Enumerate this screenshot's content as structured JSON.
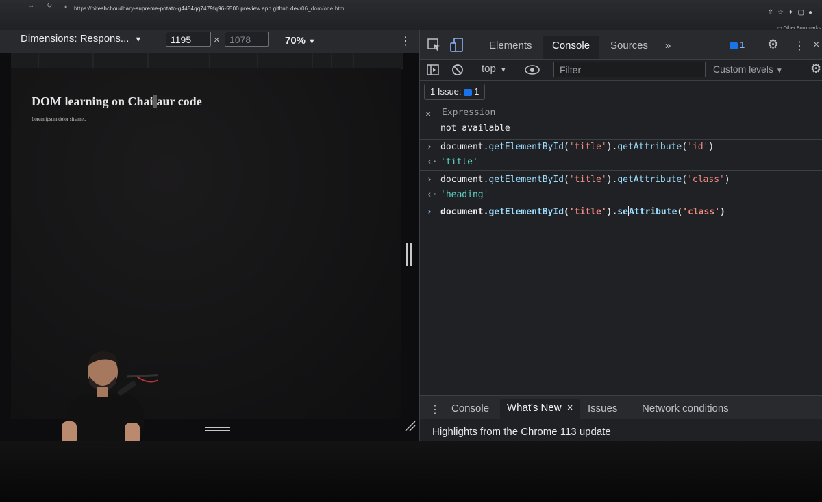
{
  "browser": {
    "url_prefix": "https://",
    "url_host": "hiteshchoudhary-supreme-potato-g4454qq7479fq96-5500.preview.app.github.dev",
    "url_path": "/06_dom/one.html",
    "bookmarks_label": "Other Bookmarks"
  },
  "device_toolbar": {
    "dimensions_label": "Dimensions: Respons...",
    "width_value": "1195",
    "height_value": "1078",
    "zoom_label": "70%"
  },
  "page": {
    "heading_before_cursor": "DOM learning on Chai",
    "heading_after_cursor": "aur code",
    "paragraph": "Lorem ipsum dolor sit amet."
  },
  "devtools": {
    "tabs": [
      "Elements",
      "Console",
      "Sources"
    ],
    "active_tab": "Console",
    "more_tabs": "»",
    "issue_count": "1",
    "console_toolbar": {
      "context": "top",
      "filter_placeholder": "Filter",
      "levels": "Custom levels"
    },
    "issues_label": "1 Issue:",
    "issues_count": "1",
    "live_expression": {
      "label": "Expression",
      "value": "not available"
    },
    "entries": [
      {
        "obj": "document",
        "dot1": ".",
        "m1": "getElementById",
        "p1": "(",
        "a1": "'title'",
        "p2": ")",
        "dot2": ".",
        "m2": "getAttribute",
        "p3": "(",
        "a2": "'id'",
        "p4": ")",
        "result": "'title'"
      },
      {
        "obj": "document",
        "dot1": ".",
        "m1": "getElementById",
        "p1": "(",
        "a1": "'title'",
        "p2": ")",
        "dot2": ".",
        "m2": "getAttribute",
        "p3": "(",
        "a2": "'class'",
        "p4": ")",
        "result": "'heading'"
      }
    ],
    "current_input": {
      "obj": "document",
      "dot1": ".",
      "m1": "getElementById",
      "p1": "(",
      "a1": "'title'",
      "p2": ")",
      "dot2": ".",
      "m2a": "se",
      "m2b": "Attribute",
      "p3": "(",
      "a2": "'class'",
      "p4": ")"
    },
    "drawer_tabs": [
      "Console",
      "What's New",
      "Issues",
      "Network conditions"
    ],
    "drawer_active": "What's New",
    "highlights_text": "Highlights from the Chrome 113 update"
  },
  "colors": {
    "devtools_bg": "#202124",
    "accent_blue": "#1a73e8",
    "string_color": "#f28b82",
    "method_color": "#9cdcfe",
    "result_color": "#5cd5c6"
  }
}
